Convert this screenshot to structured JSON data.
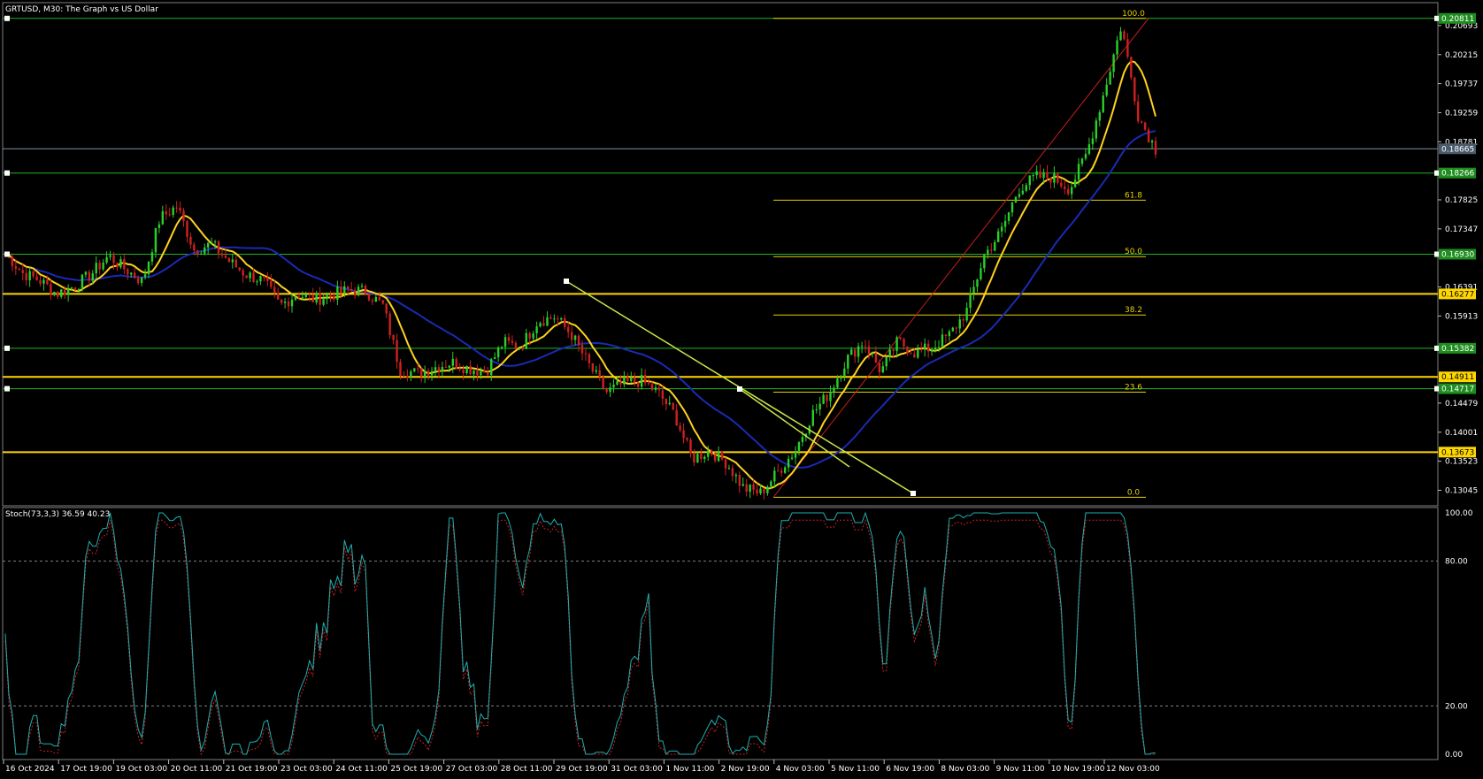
{
  "header": {
    "title": "GRTUSD, M30:  The Graph vs US Dollar",
    "stoch_label": "Stoch(73,3,3) 36.59 40.23"
  },
  "colors": {
    "background": "#000000",
    "frame": "#808080",
    "hline_green": "#22b422",
    "hline_yellow": "#ffd700",
    "fib_yellow": "#e6d200",
    "fib_diag_red": "#c81e1e",
    "trend_line": "#c8e646",
    "ma_fast": "#ffd21e",
    "ma_slow": "#1a2ab4",
    "bull_candle": "#2ad02a",
    "bear_candle": "#d02020",
    "stoch_main": "#20b0b0",
    "stoch_signal": "#d02020",
    "bid_line": "#8090a0"
  },
  "price_axis": {
    "min": 0.1279,
    "max": 0.2107,
    "ticks": [
      "0.20693",
      "0.20215",
      "0.19737",
      "0.19259",
      "0.18781",
      "0.17825",
      "0.17347",
      "0.16391",
      "0.15913",
      "0.14479",
      "0.14001",
      "0.13523",
      "0.13045"
    ],
    "tick_values": [
      0.20693,
      0.20215,
      0.19737,
      0.19259,
      0.18781,
      0.17825,
      0.17347,
      0.16391,
      0.15913,
      0.14479,
      0.14001,
      0.13523,
      0.13045
    ]
  },
  "levels": [
    {
      "price": 0.20811,
      "label": "0.20811",
      "color": "green"
    },
    {
      "price": 0.18665,
      "label": "0.18665",
      "color": "bid"
    },
    {
      "price": 0.18266,
      "label": "0.18266",
      "color": "green"
    },
    {
      "price": 0.1693,
      "label": "0.16930",
      "color": "green"
    },
    {
      "price": 0.16277,
      "label": "0.16277",
      "color": "yellow"
    },
    {
      "price": 0.15382,
      "label": "0.15382",
      "color": "green"
    },
    {
      "price": 0.14911,
      "label": "0.14911",
      "color": "yellow"
    },
    {
      "price": 0.14717,
      "label": "0.14717",
      "color": "green"
    },
    {
      "price": 0.13673,
      "label": "0.13673",
      "color": "yellow"
    }
  ],
  "fib": {
    "levels": [
      {
        "label": "100.0",
        "price": 0.20811
      },
      {
        "label": "61.8",
        "price": 0.1782
      },
      {
        "label": "50.0",
        "price": 0.1689
      },
      {
        "label": "38.2",
        "price": 0.1593
      },
      {
        "label": "23.6",
        "price": 0.1466
      },
      {
        "label": "0.0",
        "price": 0.1293
      }
    ]
  },
  "stoch_axis": {
    "ticks": [
      "100.00",
      "80.00",
      "20.00",
      "0.00"
    ],
    "tick_values": [
      100,
      80,
      20,
      0
    ]
  },
  "time_axis": {
    "labels": [
      "16 Oct 2024",
      "17 Oct 19:00",
      "19 Oct 03:00",
      "20 Oct 11:00",
      "21 Oct 19:00",
      "23 Oct 03:00",
      "24 Oct 11:00",
      "25 Oct 19:00",
      "27 Oct 03:00",
      "28 Oct 11:00",
      "29 Oct 19:00",
      "31 Oct 03:00",
      "1 Nov 11:00",
      "2 Nov 19:00",
      "4 Nov 03:00",
      "5 Nov 11:00",
      "6 Nov 19:00",
      "8 Nov 03:00",
      "9 Nov 11:00",
      "10 Nov 19:00",
      "12 Nov 03:00"
    ]
  },
  "chart_data": {
    "type": "line",
    "series": [
      {
        "values": [
          0.1695,
          0.1662,
          0.165,
          0.1628,
          0.164,
          0.166,
          0.169,
          0.1668,
          0.1648,
          0.1752,
          0.1772,
          0.17,
          0.171,
          0.1682,
          0.166,
          0.165,
          0.1608,
          0.1628,
          0.1618,
          0.1626,
          0.1634,
          0.1632,
          0.1608,
          0.1503,
          0.1497,
          0.1507,
          0.1515,
          0.1505,
          0.15,
          0.1548,
          0.154,
          0.1583,
          0.159,
          0.156,
          0.151,
          0.1466,
          0.148,
          0.1485,
          0.1466,
          0.1428,
          0.1356,
          0.137,
          0.135,
          0.1308,
          0.13,
          0.1335,
          0.137,
          0.143,
          0.1465,
          0.152,
          0.155,
          0.15,
          0.155,
          0.153,
          0.154,
          0.156,
          0.16,
          0.169,
          0.173,
          0.18,
          0.182,
          0.182,
          0.18,
          0.186,
          0.196,
          0.207,
          0.192,
          0.1866
        ]
      }
    ]
  }
}
